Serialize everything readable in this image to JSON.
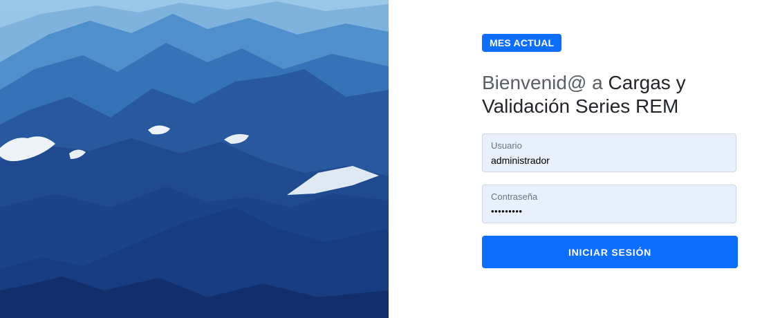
{
  "badge": {
    "label": "MES ACTUAL"
  },
  "heading": {
    "prefix": "Bienvenid@ a ",
    "app_name": "Cargas y Validación Series REM"
  },
  "form": {
    "username": {
      "label": "Usuario",
      "value": "administrador"
    },
    "password": {
      "label": "Contraseña",
      "value": "•••••••••"
    },
    "submit_label": "INICIAR SESIÓN"
  },
  "colors": {
    "primary": "#0d6efd",
    "input_background": "#e8f0fe"
  },
  "hero": {
    "image": "mountain-landscape"
  }
}
